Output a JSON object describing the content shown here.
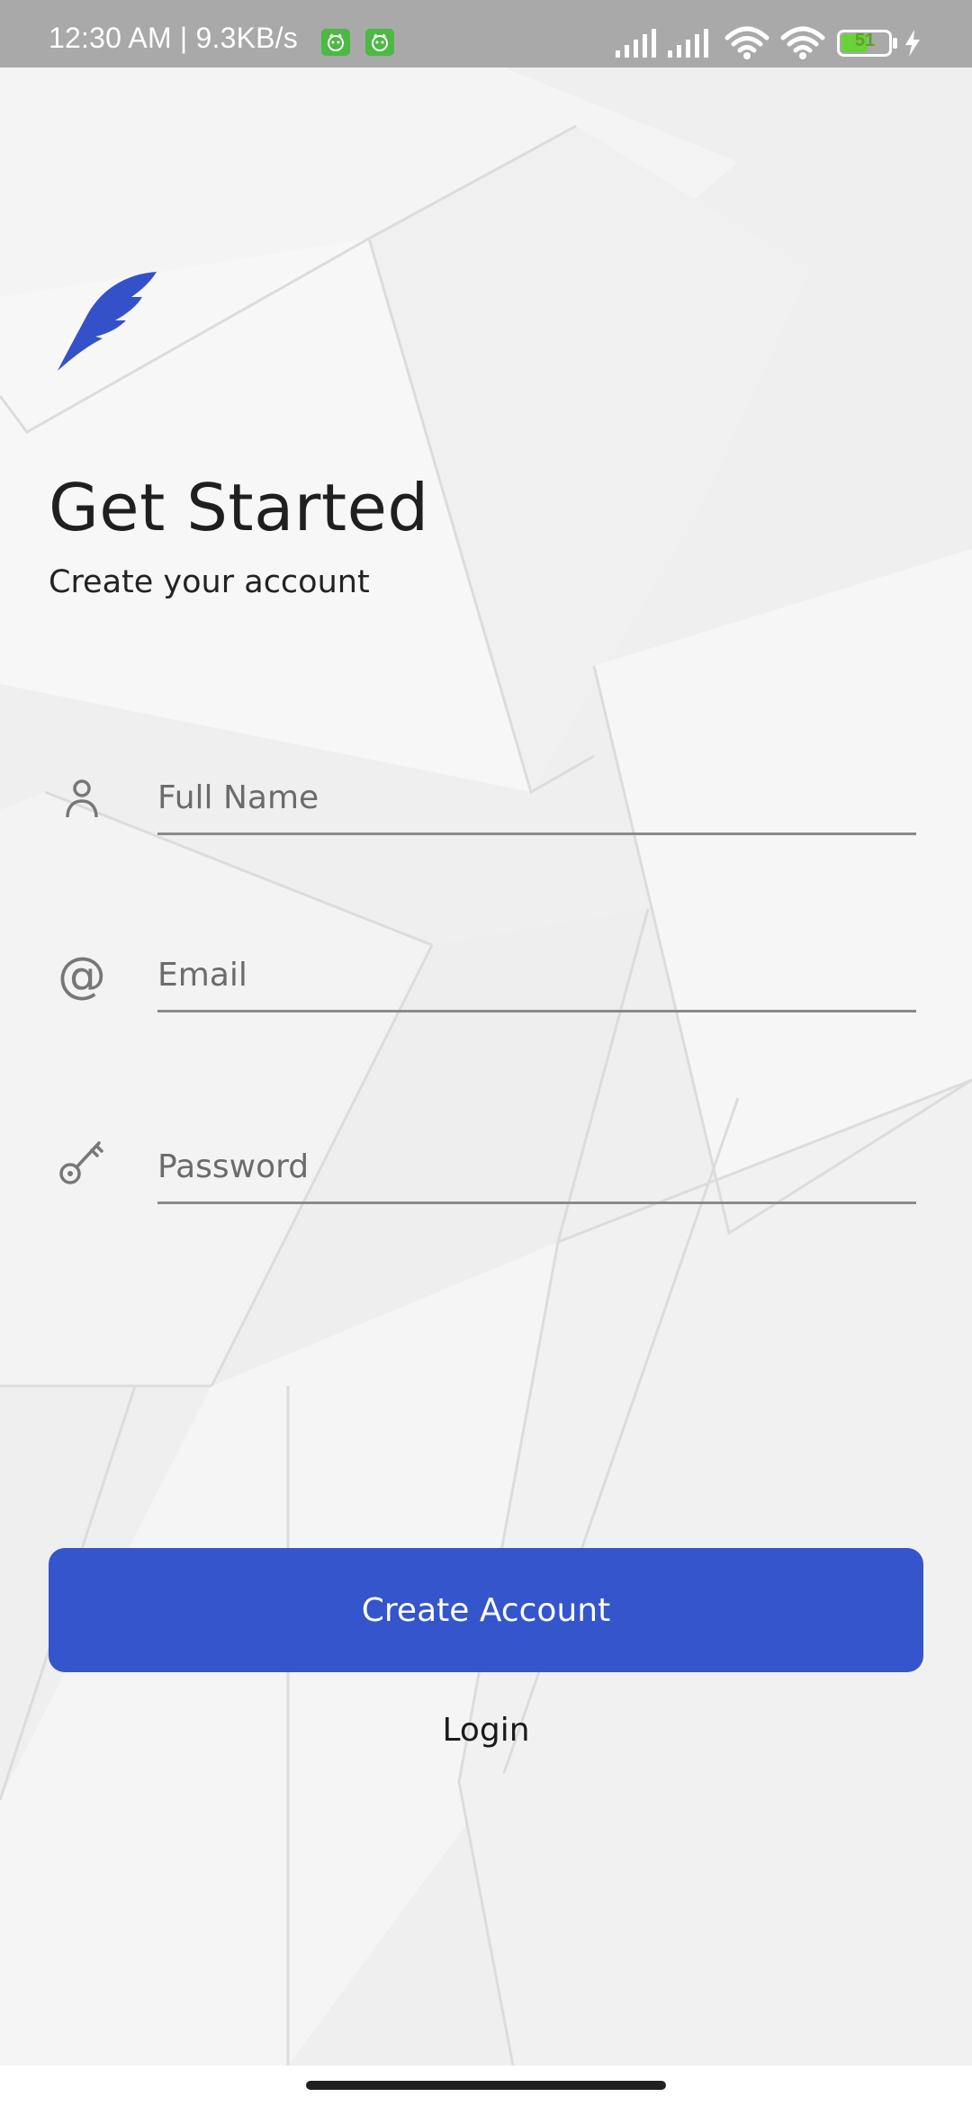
{
  "status_bar": {
    "time_speed": "12:30 AM | 9.3KB/s",
    "battery_level": "51",
    "icons": [
      "notification-app-icon",
      "notification-app-icon",
      "signal-icon",
      "signal-icon",
      "wifi-icon",
      "wifi-icon",
      "battery-icon",
      "charging-icon"
    ]
  },
  "header": {
    "logo_icon": "feather-icon",
    "title": "Get Started",
    "subtitle": "Create your account"
  },
  "form": {
    "full_name": {
      "icon": "person-icon",
      "placeholder": "Full Name",
      "value": ""
    },
    "email": {
      "icon": "at-sign-icon",
      "placeholder": "Email",
      "value": ""
    },
    "password": {
      "icon": "key-icon",
      "placeholder": "Password",
      "value": ""
    }
  },
  "actions": {
    "create_account_label": "Create Account",
    "login_label": "Login"
  },
  "colors": {
    "accent": "#3455cb",
    "status_bar": "#a9a9a9",
    "background": "#f2f2f2"
  }
}
